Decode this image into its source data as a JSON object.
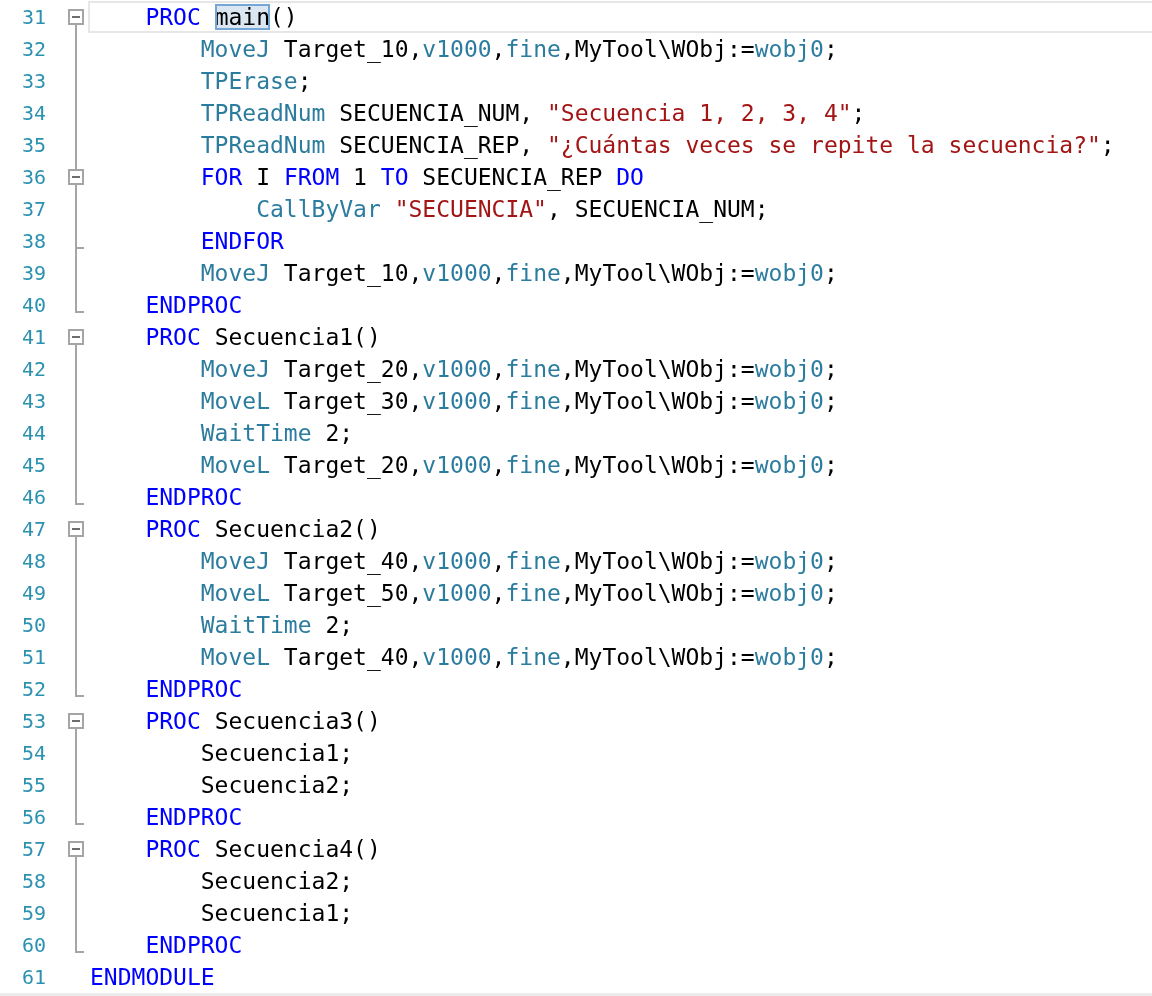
{
  "editor": {
    "lines": [
      {
        "number": "31",
        "kind": "start",
        "current": true,
        "tokens": [
          {
            "kind": "keyword",
            "text": "    PROC "
          },
          {
            "kind": "match",
            "text": "main"
          },
          {
            "kind": "plain",
            "text": "()"
          }
        ]
      },
      {
        "number": "32",
        "kind": "mid",
        "current": false,
        "tokens": [
          {
            "kind": "builtin",
            "text": "        MoveJ"
          },
          {
            "kind": "plain",
            "text": " Target_10,"
          },
          {
            "kind": "builtin",
            "text": "v1000"
          },
          {
            "kind": "plain",
            "text": ","
          },
          {
            "kind": "builtin",
            "text": "fine"
          },
          {
            "kind": "plain",
            "text": ",MyTool\\WObj:="
          },
          {
            "kind": "builtin",
            "text": "wobj0"
          },
          {
            "kind": "plain",
            "text": ";"
          }
        ]
      },
      {
        "number": "33",
        "kind": "mid",
        "current": false,
        "tokens": [
          {
            "kind": "builtin",
            "text": "        TPErase"
          },
          {
            "kind": "plain",
            "text": ";"
          }
        ]
      },
      {
        "number": "34",
        "kind": "mid",
        "current": false,
        "tokens": [
          {
            "kind": "builtin",
            "text": "        TPReadNum"
          },
          {
            "kind": "plain",
            "text": " SECUENCIA_NUM, "
          },
          {
            "kind": "string",
            "text": "\"Secuencia 1, 2, 3, 4\""
          },
          {
            "kind": "plain",
            "text": ";"
          }
        ]
      },
      {
        "number": "35",
        "kind": "mid",
        "current": false,
        "tokens": [
          {
            "kind": "builtin",
            "text": "        TPReadNum"
          },
          {
            "kind": "plain",
            "text": " SECUENCIA_REP, "
          },
          {
            "kind": "string",
            "text": "\"¿Cuántas veces se repite la secuencia?\""
          },
          {
            "kind": "plain",
            "text": ";"
          }
        ]
      },
      {
        "number": "36",
        "kind": "nested-start",
        "current": false,
        "tokens": [
          {
            "kind": "keyword",
            "text": "        FOR"
          },
          {
            "kind": "plain",
            "text": " I "
          },
          {
            "kind": "keyword",
            "text": "FROM"
          },
          {
            "kind": "plain",
            "text": " 1 "
          },
          {
            "kind": "keyword",
            "text": "TO"
          },
          {
            "kind": "plain",
            "text": " SECUENCIA_REP "
          },
          {
            "kind": "keyword",
            "text": "DO"
          }
        ]
      },
      {
        "number": "37",
        "kind": "mid",
        "current": false,
        "tokens": [
          {
            "kind": "builtin",
            "text": "            CallByVar "
          },
          {
            "kind": "string",
            "text": "\"SECUENCIA\""
          },
          {
            "kind": "plain",
            "text": ", SECUENCIA_NUM;"
          }
        ]
      },
      {
        "number": "38",
        "kind": "nested-end",
        "current": false,
        "tokens": [
          {
            "kind": "keyword",
            "text": "        ENDFOR"
          }
        ]
      },
      {
        "number": "39",
        "kind": "mid",
        "current": false,
        "tokens": [
          {
            "kind": "builtin",
            "text": "        MoveJ"
          },
          {
            "kind": "plain",
            "text": " Target_10,"
          },
          {
            "kind": "builtin",
            "text": "v1000"
          },
          {
            "kind": "plain",
            "text": ","
          },
          {
            "kind": "builtin",
            "text": "fine"
          },
          {
            "kind": "plain",
            "text": ",MyTool\\WObj:="
          },
          {
            "kind": "builtin",
            "text": "wobj0"
          },
          {
            "kind": "plain",
            "text": ";"
          }
        ]
      },
      {
        "number": "40",
        "kind": "end",
        "current": false,
        "tokens": [
          {
            "kind": "keyword",
            "text": "    ENDPROC"
          }
        ]
      },
      {
        "number": "41",
        "kind": "start",
        "current": false,
        "tokens": [
          {
            "kind": "keyword",
            "text": "    PROC"
          },
          {
            "kind": "plain",
            "text": " Secuencia1()"
          }
        ]
      },
      {
        "number": "42",
        "kind": "mid",
        "current": false,
        "tokens": [
          {
            "kind": "builtin",
            "text": "        MoveJ"
          },
          {
            "kind": "plain",
            "text": " Target_20,"
          },
          {
            "kind": "builtin",
            "text": "v1000"
          },
          {
            "kind": "plain",
            "text": ","
          },
          {
            "kind": "builtin",
            "text": "fine"
          },
          {
            "kind": "plain",
            "text": ",MyTool\\WObj:="
          },
          {
            "kind": "builtin",
            "text": "wobj0"
          },
          {
            "kind": "plain",
            "text": ";"
          }
        ]
      },
      {
        "number": "43",
        "kind": "mid",
        "current": false,
        "tokens": [
          {
            "kind": "builtin",
            "text": "        MoveL"
          },
          {
            "kind": "plain",
            "text": " Target_30,"
          },
          {
            "kind": "builtin",
            "text": "v1000"
          },
          {
            "kind": "plain",
            "text": ","
          },
          {
            "kind": "builtin",
            "text": "fine"
          },
          {
            "kind": "plain",
            "text": ",MyTool\\WObj:="
          },
          {
            "kind": "builtin",
            "text": "wobj0"
          },
          {
            "kind": "plain",
            "text": ";"
          }
        ]
      },
      {
        "number": "44",
        "kind": "mid",
        "current": false,
        "tokens": [
          {
            "kind": "builtin",
            "text": "        WaitTime"
          },
          {
            "kind": "plain",
            "text": " 2;"
          }
        ]
      },
      {
        "number": "45",
        "kind": "mid",
        "current": false,
        "tokens": [
          {
            "kind": "builtin",
            "text": "        MoveL"
          },
          {
            "kind": "plain",
            "text": " Target_20,"
          },
          {
            "kind": "builtin",
            "text": "v1000"
          },
          {
            "kind": "plain",
            "text": ","
          },
          {
            "kind": "builtin",
            "text": "fine"
          },
          {
            "kind": "plain",
            "text": ",MyTool\\WObj:="
          },
          {
            "kind": "builtin",
            "text": "wobj0"
          },
          {
            "kind": "plain",
            "text": ";"
          }
        ]
      },
      {
        "number": "46",
        "kind": "end",
        "current": false,
        "tokens": [
          {
            "kind": "keyword",
            "text": "    ENDPROC"
          }
        ]
      },
      {
        "number": "47",
        "kind": "start",
        "current": false,
        "tokens": [
          {
            "kind": "keyword",
            "text": "    PROC"
          },
          {
            "kind": "plain",
            "text": " Secuencia2()"
          }
        ]
      },
      {
        "number": "48",
        "kind": "mid",
        "current": false,
        "tokens": [
          {
            "kind": "builtin",
            "text": "        MoveJ"
          },
          {
            "kind": "plain",
            "text": " Target_40,"
          },
          {
            "kind": "builtin",
            "text": "v1000"
          },
          {
            "kind": "plain",
            "text": ","
          },
          {
            "kind": "builtin",
            "text": "fine"
          },
          {
            "kind": "plain",
            "text": ",MyTool\\WObj:="
          },
          {
            "kind": "builtin",
            "text": "wobj0"
          },
          {
            "kind": "plain",
            "text": ";"
          }
        ]
      },
      {
        "number": "49",
        "kind": "mid",
        "current": false,
        "tokens": [
          {
            "kind": "builtin",
            "text": "        MoveL"
          },
          {
            "kind": "plain",
            "text": " Target_50,"
          },
          {
            "kind": "builtin",
            "text": "v1000"
          },
          {
            "kind": "plain",
            "text": ","
          },
          {
            "kind": "builtin",
            "text": "fine"
          },
          {
            "kind": "plain",
            "text": ",MyTool\\WObj:="
          },
          {
            "kind": "builtin",
            "text": "wobj0"
          },
          {
            "kind": "plain",
            "text": ";"
          }
        ]
      },
      {
        "number": "50",
        "kind": "mid",
        "current": false,
        "tokens": [
          {
            "kind": "builtin",
            "text": "        WaitTime"
          },
          {
            "kind": "plain",
            "text": " 2;"
          }
        ]
      },
      {
        "number": "51",
        "kind": "mid",
        "current": false,
        "tokens": [
          {
            "kind": "builtin",
            "text": "        MoveL"
          },
          {
            "kind": "plain",
            "text": " Target_40,"
          },
          {
            "kind": "builtin",
            "text": "v1000"
          },
          {
            "kind": "plain",
            "text": ","
          },
          {
            "kind": "builtin",
            "text": "fine"
          },
          {
            "kind": "plain",
            "text": ",MyTool\\WObj:="
          },
          {
            "kind": "builtin",
            "text": "wobj0"
          },
          {
            "kind": "plain",
            "text": ";"
          }
        ]
      },
      {
        "number": "52",
        "kind": "end",
        "current": false,
        "tokens": [
          {
            "kind": "keyword",
            "text": "    ENDPROC"
          }
        ]
      },
      {
        "number": "53",
        "kind": "start",
        "current": false,
        "tokens": [
          {
            "kind": "keyword",
            "text": "    PROC"
          },
          {
            "kind": "plain",
            "text": " Secuencia3()"
          }
        ]
      },
      {
        "number": "54",
        "kind": "mid",
        "current": false,
        "tokens": [
          {
            "kind": "plain",
            "text": "        Secuencia1;"
          }
        ]
      },
      {
        "number": "55",
        "kind": "mid",
        "current": false,
        "tokens": [
          {
            "kind": "plain",
            "text": "        Secuencia2;"
          }
        ]
      },
      {
        "number": "56",
        "kind": "end",
        "current": false,
        "tokens": [
          {
            "kind": "keyword",
            "text": "    ENDPROC"
          }
        ]
      },
      {
        "number": "57",
        "kind": "start",
        "current": false,
        "tokens": [
          {
            "kind": "keyword",
            "text": "    PROC"
          },
          {
            "kind": "plain",
            "text": " Secuencia4()"
          }
        ]
      },
      {
        "number": "58",
        "kind": "mid",
        "current": false,
        "tokens": [
          {
            "kind": "plain",
            "text": "        Secuencia2;"
          }
        ]
      },
      {
        "number": "59",
        "kind": "mid",
        "current": false,
        "tokens": [
          {
            "kind": "plain",
            "text": "        Secuencia1;"
          }
        ]
      },
      {
        "number": "60",
        "kind": "end",
        "current": false,
        "tokens": [
          {
            "kind": "keyword",
            "text": "    ENDPROC"
          }
        ]
      },
      {
        "number": "61",
        "kind": "none",
        "current": false,
        "tokens": [
          {
            "kind": "keyword",
            "text": "ENDMODULE"
          }
        ]
      }
    ]
  }
}
